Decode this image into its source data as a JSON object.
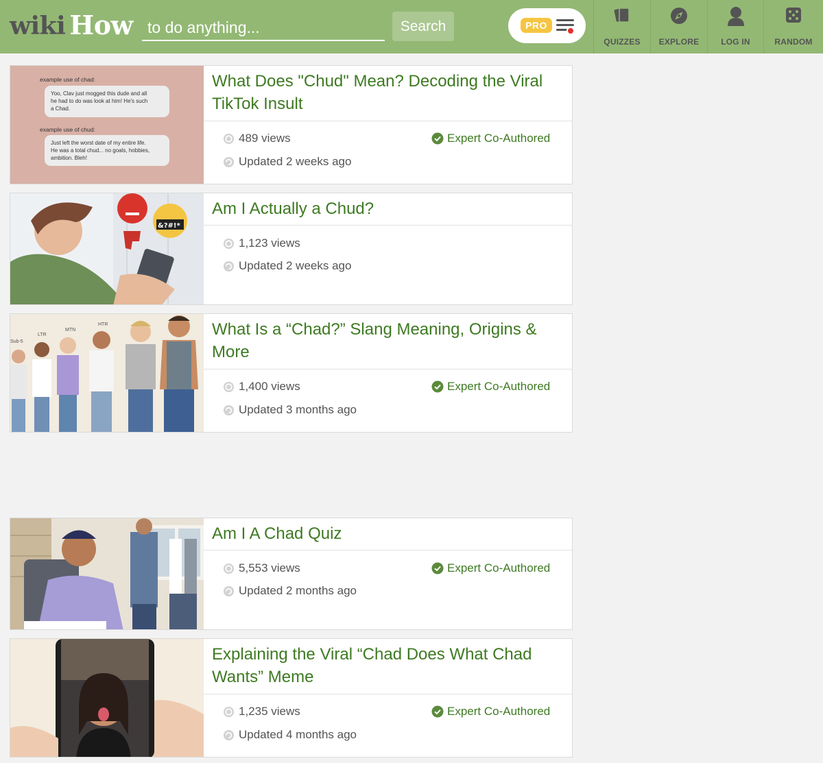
{
  "header": {
    "logo_wiki": "wiki",
    "logo_how": "How",
    "search_placeholder": "to do anything...",
    "search_button": "Search",
    "pro_badge": "PRO",
    "nav": [
      {
        "label": "QUIZZES",
        "icon": "quiz-cards-icon"
      },
      {
        "label": "EXPLORE",
        "icon": "compass-icon"
      },
      {
        "label": "LOG IN",
        "icon": "user-icon"
      },
      {
        "label": "RANDOM",
        "icon": "dice-icon"
      }
    ]
  },
  "articles": [
    {
      "title": "What Does \"Chud\" Mean? Decoding the Viral TikTok Insult",
      "views": "489 views",
      "updated": "Updated 2 weeks ago",
      "expert": "Expert Co-Authored",
      "thumb_text": [
        "example use of chad:",
        "Yoo, Clav just mogged this dude and all",
        "he had to do was look at him! He's such",
        "a Chad.",
        "example use of chud:",
        "Just left the worst date of my entire life.",
        "He was a total chud... no goals, hobbies,",
        "ambition. Bleh!"
      ]
    },
    {
      "title": "Am I Actually a Chud?",
      "views": "1,123 views",
      "updated": "Updated 2 weeks ago",
      "expert": "",
      "thumb_text": [
        "&?#!*"
      ]
    },
    {
      "title": "What Is a “Chad?” Slang Meaning, Origins & More",
      "views": "1,400 views",
      "updated": "Updated 3 months ago",
      "expert": "Expert Co-Authored",
      "thumb_text": [
        "Sub-5",
        "LTR",
        "MTN",
        "HTR"
      ]
    },
    {
      "title": "Am I A Chad Quiz",
      "views": "5,553 views",
      "updated": "Updated 2 months ago",
      "expert": "Expert Co-Authored",
      "thumb_text": []
    },
    {
      "title": "Explaining the Viral “Chad Does What Chad Wants” Meme",
      "views": "1,235 views",
      "updated": "Updated 4 months ago",
      "expert": "Expert Co-Authored",
      "thumb_text": []
    }
  ],
  "colors": {
    "header_bg": "#93b874",
    "title_green": "#3e7a22",
    "pro_yellow": "#f5c542",
    "notification_red": "#e0312d"
  }
}
